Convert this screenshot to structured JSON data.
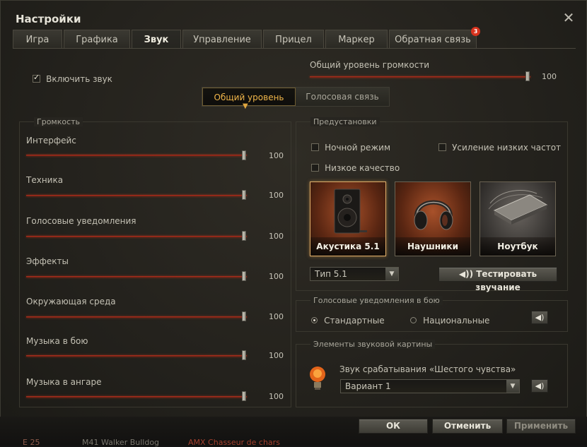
{
  "window": {
    "title": "Настройки"
  },
  "tabs": [
    {
      "label": "Игра",
      "active": false
    },
    {
      "label": "Графика",
      "active": false
    },
    {
      "label": "Звук",
      "active": true
    },
    {
      "label": "Управление",
      "active": false
    },
    {
      "label": "Прицел",
      "active": false
    },
    {
      "label": "Маркер",
      "active": false
    },
    {
      "label": "Обратная связь",
      "active": false,
      "badge": "3"
    }
  ],
  "enable_sound": {
    "label": "Включить звук",
    "checked": true
  },
  "master_volume": {
    "label": "Общий уровень громкости",
    "value": "100"
  },
  "mode_switch": {
    "options": [
      "Общий уровень",
      "Голосовая связь"
    ],
    "selected": "Общий уровень"
  },
  "volume": {
    "group_label": "Громкость",
    "sliders": [
      {
        "label": "Интерфейс",
        "value": "100"
      },
      {
        "label": "Техника",
        "value": "100"
      },
      {
        "label": "Голосовые уведомления",
        "value": "100"
      },
      {
        "label": "Эффекты",
        "value": "100"
      },
      {
        "label": "Окружающая среда",
        "value": "100"
      },
      {
        "label": "Музыка в бою",
        "value": "100"
      },
      {
        "label": "Музыка в ангаре",
        "value": "100"
      }
    ]
  },
  "presets": {
    "group_label": "Предустановки",
    "night_mode": {
      "label": "Ночной режим",
      "checked": false
    },
    "bass_boost": {
      "label": "Усиление низких частот",
      "checked": false
    },
    "low_quality": {
      "label": "Низкое качество",
      "checked": false
    },
    "cards": [
      {
        "label": "Акустика 5.1",
        "icon": "speaker-icon",
        "selected": true
      },
      {
        "label": "Наушники",
        "icon": "headphones-icon",
        "selected": false
      },
      {
        "label": "Ноутбук",
        "icon": "laptop-icon",
        "selected": false
      }
    ],
    "type_select": "Тип 5.1",
    "test_button": "Тестировать звучание"
  },
  "voice_notifications": {
    "group_label": "Голосовые уведомления в бою",
    "options": [
      "Стандартные",
      "Национальные"
    ],
    "selected": "Стандартные"
  },
  "sound_elements": {
    "group_label": "Элементы звуковой картины",
    "sixth_sense_label": "Звук срабатывания «Шестого чувства»",
    "sixth_sense_select": "Вариант 1"
  },
  "footer": {
    "ok": "ОК",
    "cancel": "Отменить",
    "apply": "Применить"
  },
  "background_text": {
    "left": "E 25",
    "mid": "M41 Walker Bulldog",
    "right": "AMX Chasseur de chars"
  },
  "colors": {
    "accent": "#f0b64a",
    "slider": "#b4321f",
    "badge": "#d7321d"
  }
}
